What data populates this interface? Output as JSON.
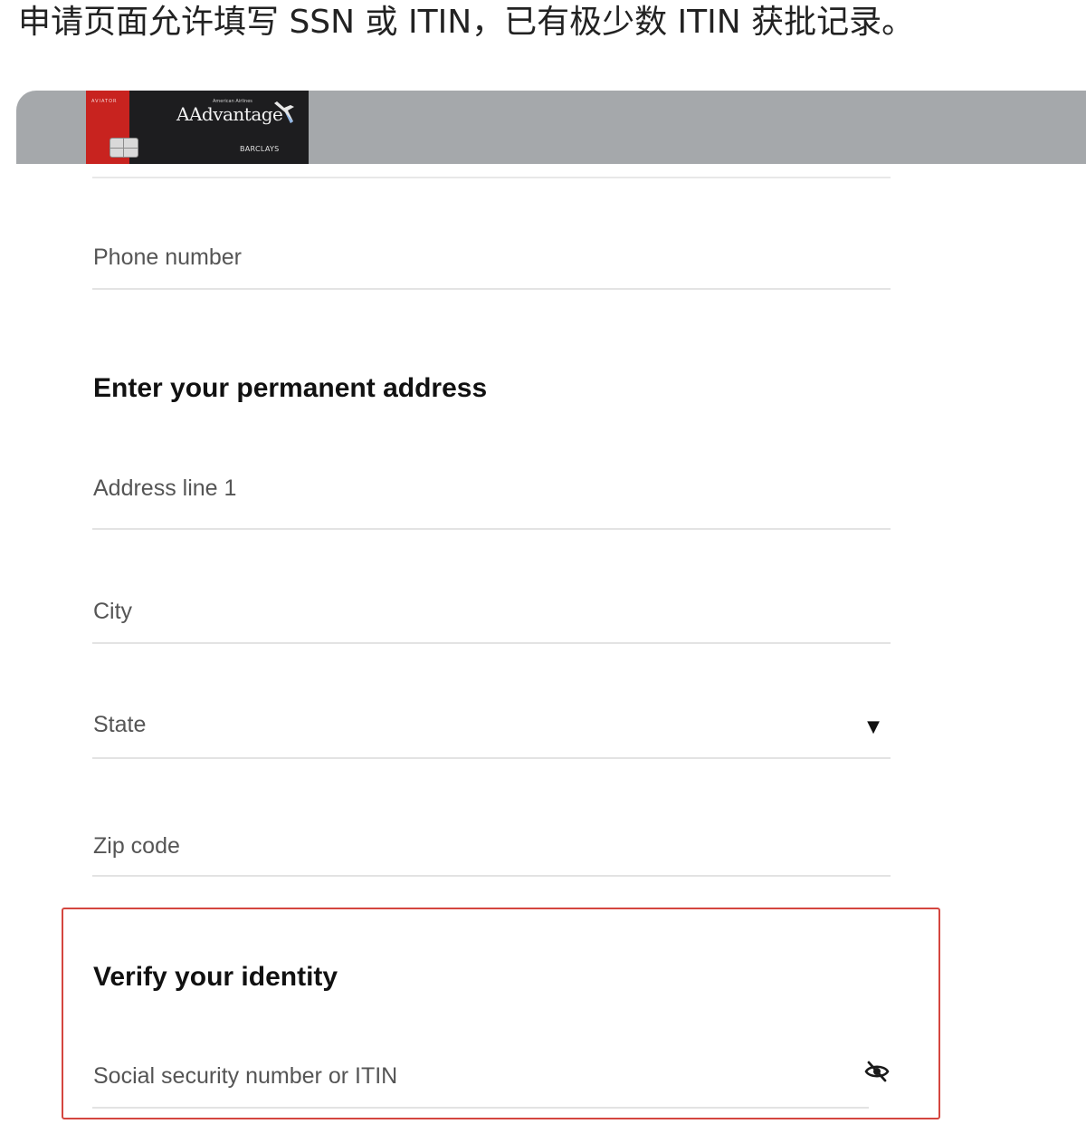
{
  "caption": "申请页面允许填写 SSN 或 ITIN，已有极少数 ITIN 获批记录。",
  "card": {
    "brand": "AAdvantage",
    "top_small_text": "AVIATOR",
    "top_right_text": "American Airlines",
    "issuer": "BARCLAYS",
    "accent_color": "#c8231f"
  },
  "form": {
    "phone": {
      "label": "Phone number"
    },
    "address_heading": "Enter your permanent address",
    "address_line1": {
      "label": "Address line 1"
    },
    "city": {
      "label": "City"
    },
    "state": {
      "label": "State",
      "caret": "▼"
    },
    "zip": {
      "label": "Zip code"
    },
    "identity_heading": "Verify your identity",
    "ssn": {
      "label": "Social security number or ITIN",
      "toggle_icon": "eye-off-icon"
    }
  },
  "colors": {
    "banner": "#a5a8ab",
    "highlight_border": "#d4463f"
  }
}
